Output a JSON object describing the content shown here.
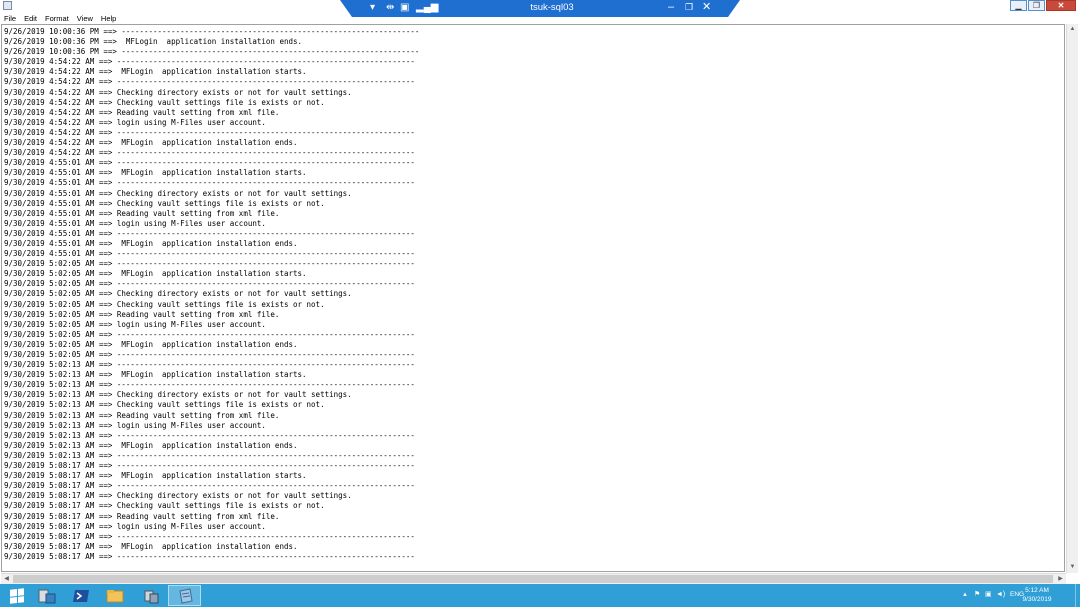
{
  "window": {
    "controls": {
      "minimize": "▁",
      "maximize": "❐",
      "close": "✕"
    }
  },
  "rdp_bar": {
    "title": "tsuk-sql03",
    "icons": [
      "pin-icon",
      "move-icon",
      "lock-icon",
      "signal-icon"
    ],
    "controls": {
      "minimize": "–",
      "restore": "❐",
      "close": "✕"
    }
  },
  "menu": {
    "items": [
      "File",
      "Edit",
      "Format",
      "View",
      "Help"
    ]
  },
  "log_lines": [
    "9/26/2019 10:00:36 PM ==> ------------------------------------------------------------------",
    "9/26/2019 10:00:36 PM ==>  MFLogin  application installation ends.",
    "9/26/2019 10:00:36 PM ==> ------------------------------------------------------------------",
    "9/30/2019 4:54:22 AM ==> ------------------------------------------------------------------",
    "9/30/2019 4:54:22 AM ==>  MFLogin  application installation starts.",
    "9/30/2019 4:54:22 AM ==> ------------------------------------------------------------------",
    "9/30/2019 4:54:22 AM ==> Checking directory exists or not for vault settings.",
    "9/30/2019 4:54:22 AM ==> Checking vault settings file is exists or not.",
    "9/30/2019 4:54:22 AM ==> Reading vault setting from xml file.",
    "9/30/2019 4:54:22 AM ==> login using M-Files user account.",
    "9/30/2019 4:54:22 AM ==> ------------------------------------------------------------------",
    "9/30/2019 4:54:22 AM ==>  MFLogin  application installation ends.",
    "9/30/2019 4:54:22 AM ==> ------------------------------------------------------------------",
    "9/30/2019 4:55:01 AM ==> ------------------------------------------------------------------",
    "9/30/2019 4:55:01 AM ==>  MFLogin  application installation starts.",
    "9/30/2019 4:55:01 AM ==> ------------------------------------------------------------------",
    "9/30/2019 4:55:01 AM ==> Checking directory exists or not for vault settings.",
    "9/30/2019 4:55:01 AM ==> Checking vault settings file is exists or not.",
    "9/30/2019 4:55:01 AM ==> Reading vault setting from xml file.",
    "9/30/2019 4:55:01 AM ==> login using M-Files user account.",
    "9/30/2019 4:55:01 AM ==> ------------------------------------------------------------------",
    "9/30/2019 4:55:01 AM ==>  MFLogin  application installation ends.",
    "9/30/2019 4:55:01 AM ==> ------------------------------------------------------------------",
    "9/30/2019 5:02:05 AM ==> ------------------------------------------------------------------",
    "9/30/2019 5:02:05 AM ==>  MFLogin  application installation starts.",
    "9/30/2019 5:02:05 AM ==> ------------------------------------------------------------------",
    "9/30/2019 5:02:05 AM ==> Checking directory exists or not for vault settings.",
    "9/30/2019 5:02:05 AM ==> Checking vault settings file is exists or not.",
    "9/30/2019 5:02:05 AM ==> Reading vault setting from xml file.",
    "9/30/2019 5:02:05 AM ==> login using M-Files user account.",
    "9/30/2019 5:02:05 AM ==> ------------------------------------------------------------------",
    "9/30/2019 5:02:05 AM ==>  MFLogin  application installation ends.",
    "9/30/2019 5:02:05 AM ==> ------------------------------------------------------------------",
    "9/30/2019 5:02:13 AM ==> ------------------------------------------------------------------",
    "9/30/2019 5:02:13 AM ==>  MFLogin  application installation starts.",
    "9/30/2019 5:02:13 AM ==> ------------------------------------------------------------------",
    "9/30/2019 5:02:13 AM ==> Checking directory exists or not for vault settings.",
    "9/30/2019 5:02:13 AM ==> Checking vault settings file is exists or not.",
    "9/30/2019 5:02:13 AM ==> Reading vault setting from xml file.",
    "9/30/2019 5:02:13 AM ==> login using M-Files user account.",
    "9/30/2019 5:02:13 AM ==> ------------------------------------------------------------------",
    "9/30/2019 5:02:13 AM ==>  MFLogin  application installation ends.",
    "9/30/2019 5:02:13 AM ==> ------------------------------------------------------------------",
    "9/30/2019 5:08:17 AM ==> ------------------------------------------------------------------",
    "9/30/2019 5:08:17 AM ==>  MFLogin  application installation starts.",
    "9/30/2019 5:08:17 AM ==> ------------------------------------------------------------------",
    "9/30/2019 5:08:17 AM ==> Checking directory exists or not for vault settings.",
    "9/30/2019 5:08:17 AM ==> Checking vault settings file is exists or not.",
    "9/30/2019 5:08:17 AM ==> Reading vault setting from xml file.",
    "9/30/2019 5:08:17 AM ==> login using M-Files user account.",
    "9/30/2019 5:08:17 AM ==> ------------------------------------------------------------------",
    "9/30/2019 5:08:17 AM ==>  MFLogin  application installation ends.",
    "9/30/2019 5:08:17 AM ==> ------------------------------------------------------------------"
  ],
  "scrollbars": {
    "up": "▲",
    "down": "▼",
    "left": "◀",
    "right": "▶"
  },
  "taskbar": {
    "buttons": [
      {
        "name": "start-button",
        "icon": "windows-logo-icon"
      },
      {
        "name": "server-manager-button",
        "icon": "server-manager-icon"
      },
      {
        "name": "powershell-button",
        "icon": "powershell-icon"
      },
      {
        "name": "file-explorer-button",
        "icon": "folder-icon"
      },
      {
        "name": "network-app-button",
        "icon": "network-icon"
      },
      {
        "name": "notepad-button",
        "icon": "notepad-icon"
      }
    ],
    "tray": {
      "chevron": "▲",
      "language": "ENG",
      "time": "5:12 AM",
      "date": "9/30/2019"
    },
    "colors": {
      "background": "#2f9fd6",
      "accent": "#1e6fcf"
    }
  }
}
